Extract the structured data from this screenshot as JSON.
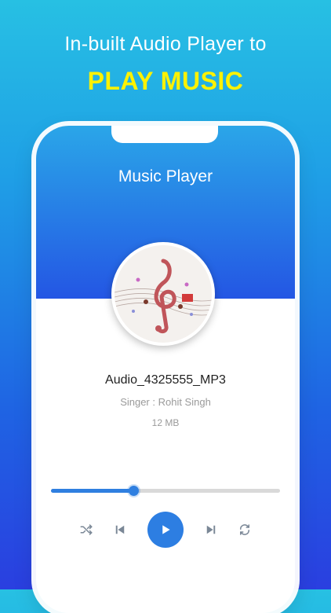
{
  "promo": {
    "line1": "In-built Audio Player to",
    "line2": "PLAY MUSIC"
  },
  "player": {
    "title": "Music Player",
    "track_name": "Audio_4325555_MP3",
    "singer": "Singer : Rohit Singh",
    "size": "12 MB",
    "progress": 0.36
  },
  "controls": {
    "icons": [
      "shuffle-icon",
      "skip-previous-icon",
      "play-icon",
      "skip-next-icon",
      "repeat-icon"
    ]
  },
  "colors": {
    "accent": "#2d7ee2",
    "promo_highlight": "#fff200",
    "header_top": "#2aa6e8",
    "header_bottom": "#2456e4"
  }
}
